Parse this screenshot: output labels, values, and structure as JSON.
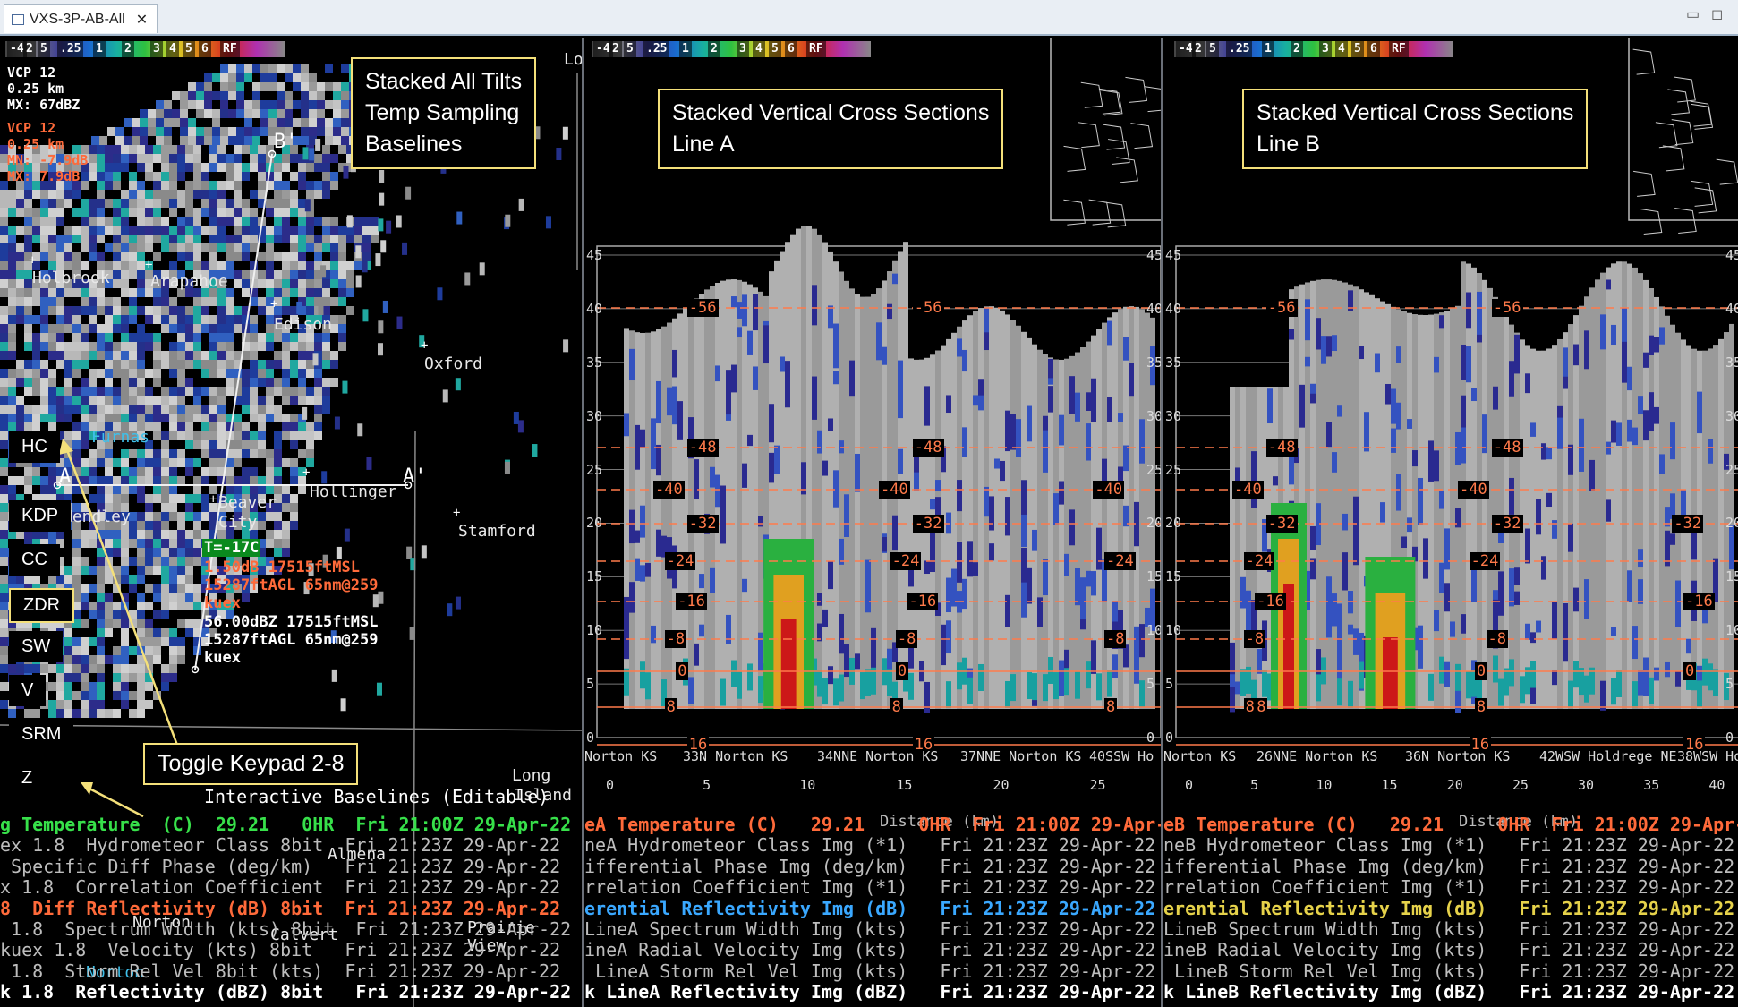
{
  "tab": {
    "title": "VXS-3P-AB-All",
    "close": "✕"
  },
  "window": {
    "minimize": "▭",
    "maximize": "◻"
  },
  "colorbar_labels": [
    "-4",
    "2",
    "5",
    ".25",
    "1",
    "2",
    "3",
    "4",
    "5",
    "6",
    "RF"
  ],
  "left": {
    "vcp1": [
      "VCP 12",
      "0.25 km",
      "MX: 67dBZ"
    ],
    "vcp2": [
      "VCP 12",
      "0.25 km",
      "MN: -7.9dB",
      "MX: 7.9dB"
    ],
    "annotation": "Stacked All Tilts\nTemp Sampling\nBaselines",
    "keypad": [
      "HC",
      "KDP",
      "CC",
      "ZDR",
      "SW",
      "V",
      "SRM",
      "Z"
    ],
    "keypad_selected": "ZDR",
    "callout": "Toggle Keypad 2-8",
    "cities": [
      "Holbrook",
      "Arapahoe",
      "Edison",
      "Oxford",
      "Furnas",
      "Hollinger",
      "Beaver",
      "City",
      "Hendley",
      "Stamford",
      "Long",
      "Island",
      "Almena",
      "Norton",
      "Calvert",
      "Prairie",
      "View",
      "Norton",
      "Lo"
    ],
    "baseline_labels": [
      "B'",
      "A",
      "A'"
    ],
    "readout_temp": "T=-17C",
    "readout_zdr": [
      "1.50dB 17515ftMSL",
      "15287ftAGL 65nm@259",
      "kuex"
    ],
    "readout_z": [
      "56.00dBZ 17515ftMSL",
      "15287ftAGL 65nm@259",
      "kuex"
    ],
    "interactive": "Interactive Baselines (Editable)",
    "legend": [
      {
        "text": "g Temperature  (C)  29.21   0HR  Fri 21:00Z 29-Apr-22",
        "color": "#37e04a"
      },
      {
        "text": "ex 1.8  Hydrometeor Class 8bit  Fri 21:23Z 29-Apr-22",
        "color": "#bdbdbd"
      },
      {
        "text": " Specific Diff Phase (deg/km)   Fri 21:23Z 29-Apr-22",
        "color": "#bdbdbd"
      },
      {
        "text": "x 1.8  Correlation Coefficient  Fri 21:23Z 29-Apr-22",
        "color": "#bdbdbd"
      },
      {
        "text": "8  Diff Reflectivity (dB) 8bit  Fri 21:23Z 29-Apr-22",
        "color": "#ff6a3a"
      },
      {
        "text": " 1.8  Spectrum Width (kts) 8bit  Fri 21:23Z 29-Apr-22",
        "color": "#bdbdbd"
      },
      {
        "text": "kuex 1.8  Velocity (kts) 8bit   Fri 21:23Z 29-Apr-22",
        "color": "#bdbdbd"
      },
      {
        "text": " 1.8  Storm Rel Vel 8bit (kts)  Fri 21:23Z 29-Apr-22",
        "color": "#bdbdbd"
      },
      {
        "text": "k 1.8  Reflectivity (dBZ) 8bit   Fri 21:23Z 29-Apr-22",
        "color": "#ffffff"
      }
    ]
  },
  "middle": {
    "annotation": "Stacked Vertical Cross Sections\nLine A",
    "y_ticks": [
      "45",
      "40",
      "35",
      "30",
      "25",
      "20",
      "15",
      "10",
      "5",
      "0"
    ],
    "temps": [
      "-56",
      "-56",
      "-48",
      "-48",
      "-40",
      "-40",
      "-40",
      "-32",
      "-32",
      "-24",
      "-24",
      "-24",
      "-16",
      "-16",
      "-8",
      "-8",
      "-8",
      "0",
      "0",
      "8",
      "8",
      "8",
      "16",
      "16"
    ],
    "locations": [
      "Norton KS",
      "33N Norton KS",
      "34NNE Norton KS",
      "37NNE Norton KS",
      "40SSW Ho"
    ],
    "x_ticks": [
      "0",
      "5",
      "10",
      "15",
      "20",
      "25"
    ],
    "x_label": "Distance (km)",
    "legend": [
      {
        "text": "eA Temperature (C)   29.21     0HR  Fri 21:00Z 29-Apr-22",
        "color": "#ff6a3a"
      },
      {
        "text": "neA Hydrometeor Class Img (*1)   Fri 21:23Z 29-Apr-22",
        "color": "#bdbdbd"
      },
      {
        "text": "ifferential Phase Img (deg/km)   Fri 21:23Z 29-Apr-22",
        "color": "#bdbdbd"
      },
      {
        "text": "rrelation Coefficient Img (*1)   Fri 21:23Z 29-Apr-22",
        "color": "#bdbdbd"
      },
      {
        "text": "erential Reflectivity Img (dB)   Fri 21:23Z 29-Apr-22",
        "color": "#3aa8ff"
      },
      {
        "text": "LineA Spectrum Width Img (kts)   Fri 21:23Z 29-Apr-22",
        "color": "#bdbdbd"
      },
      {
        "text": "ineA Radial Velocity Img (kts)   Fri 21:23Z 29-Apr-22",
        "color": "#bdbdbd"
      },
      {
        "text": " LineA Storm Rel Vel Img (kts)   Fri 21:23Z 29-Apr-22",
        "color": "#bdbdbd"
      },
      {
        "text": "k LineA Reflectivity Img (dBZ)   Fri 21:23Z 29-Apr-22",
        "color": "#ffffff"
      }
    ]
  },
  "right": {
    "annotation": "Stacked Vertical Cross Sections\nLine B",
    "y_ticks": [
      "45",
      "40",
      "35",
      "30",
      "25",
      "20",
      "15",
      "10",
      "5",
      "0"
    ],
    "temps": [
      "-56",
      "-56",
      "-48",
      "-48",
      "-40",
      "-40",
      "-32",
      "-32",
      "-32",
      "-24",
      "-24",
      "-16",
      "-16",
      "-8",
      "-8",
      "0",
      "0",
      "8",
      "8",
      "8",
      "16",
      "16"
    ],
    "locations": [
      "Norton KS",
      "26NNE Norton KS",
      "36N Norton KS",
      "42WSW Holdrege NE",
      "38WSW Ho"
    ],
    "x_ticks": [
      "0",
      "5",
      "10",
      "15",
      "20",
      "25",
      "30",
      "35",
      "40"
    ],
    "x_label": "Distance (km)",
    "legend": [
      {
        "text": "eB Temperature (C)   29.21     0HR  Fri 21:00Z 29-Apr-22",
        "color": "#ff6a3a"
      },
      {
        "text": "neB Hydrometeor Class Img (*1)   Fri 21:23Z 29-Apr-22",
        "color": "#bdbdbd"
      },
      {
        "text": "ifferential Phase Img (deg/km)   Fri 21:23Z 29-Apr-22",
        "color": "#bdbdbd"
      },
      {
        "text": "rrelation Coefficient Img (*1)   Fri 21:23Z 29-Apr-22",
        "color": "#bdbdbd"
      },
      {
        "text": "erential Reflectivity Img (dB)   Fri 21:23Z 29-Apr-22",
        "color": "#e6d24a"
      },
      {
        "text": "LineB Spectrum Width Img (kts)   Fri 21:23Z 29-Apr-22",
        "color": "#bdbdbd"
      },
      {
        "text": "ineB Radial Velocity Img (kts)   Fri 21:23Z 29-Apr-22",
        "color": "#bdbdbd"
      },
      {
        "text": " LineB Storm Rel Vel Img (kts)   Fri 21:23Z 29-Apr-22",
        "color": "#bdbdbd"
      },
      {
        "text": "k LineB Reflectivity Img (dBZ)   Fri 21:23Z 29-Apr-22",
        "color": "#ffffff"
      }
    ]
  }
}
